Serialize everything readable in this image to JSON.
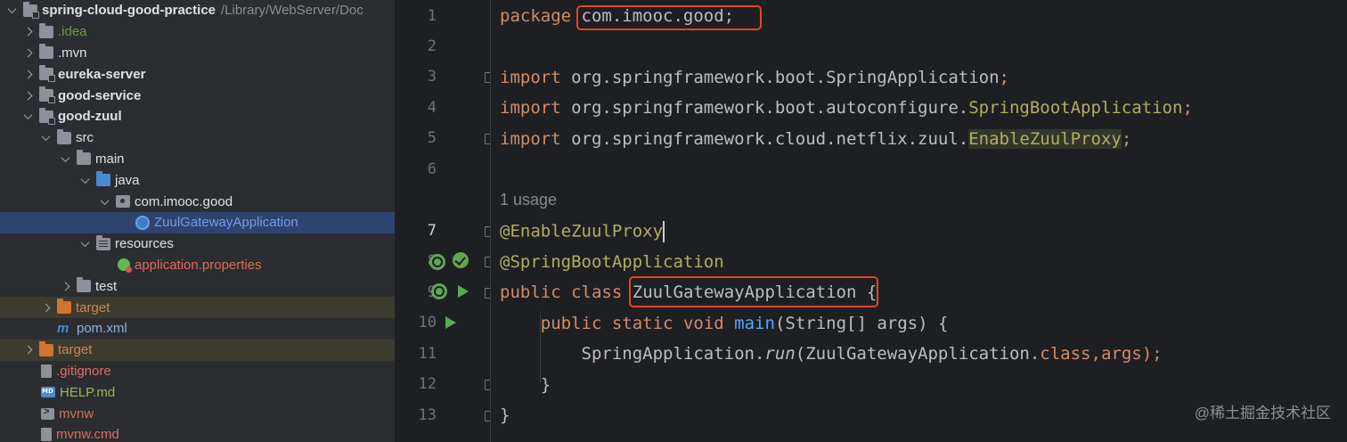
{
  "project_tree": {
    "root_name": "spring-cloud-good-practice",
    "root_path": "/Library/WebServer/Doc",
    "items": [
      {
        "label": ".idea"
      },
      {
        "label": ".mvn"
      },
      {
        "label": "eureka-server"
      },
      {
        "label": "good-service"
      },
      {
        "label": "good-zuul"
      },
      {
        "label": "src"
      },
      {
        "label": "main"
      },
      {
        "label": "java"
      },
      {
        "label": "com.imooc.good"
      },
      {
        "label": "ZuulGatewayApplication"
      },
      {
        "label": "resources"
      },
      {
        "label": "application.properties"
      },
      {
        "label": "test"
      },
      {
        "label": "target"
      },
      {
        "label": "pom.xml"
      },
      {
        "label": "target"
      },
      {
        "label": ".gitignore"
      },
      {
        "label": "HELP.md"
      },
      {
        "label": "mvnw"
      },
      {
        "label": "mvnw.cmd"
      }
    ]
  },
  "editor": {
    "line_numbers": [
      "1",
      "2",
      "3",
      "4",
      "5",
      "6",
      "7",
      "8",
      "9",
      "10",
      "11",
      "12",
      "13"
    ],
    "current_line": "7",
    "usage_hint": "1 usage",
    "code": {
      "kw_package": "package",
      "package_name": "com.imooc.good;",
      "kw_import": "import",
      "import1_path": "org.springframework.boot.SpringApplication",
      "import2_path": "org.springframework.boot.autoconfigure.",
      "import2_class": "SpringBootApplication",
      "import3_path": "org.springframework.cloud.netflix.zuul.",
      "import3_class": "EnableZuulProxy",
      "semicolon": ";",
      "annotation1": "@EnableZuulProxy",
      "annotation2": "@SpringBootApplication",
      "kw_public": "public",
      "kw_class": "class",
      "class_name": "ZuulGatewayApplication",
      "open_brace": "{",
      "kw_static": "static",
      "kw_void": "void",
      "method_name": "main",
      "method_params": "(String[] args) {",
      "call_target": "SpringApplication.",
      "call_method": "run",
      "call_args_open": "(ZuulGatewayApplication.",
      "kw_class_literal": "class",
      "call_args_close": ",args);",
      "close_brace": "}"
    }
  },
  "watermark": "@稀土掘金技术社区",
  "colors": {
    "highlight_box": "#e8442c",
    "selected_row": "#2e436e",
    "run_icon": "#4fb14c"
  }
}
